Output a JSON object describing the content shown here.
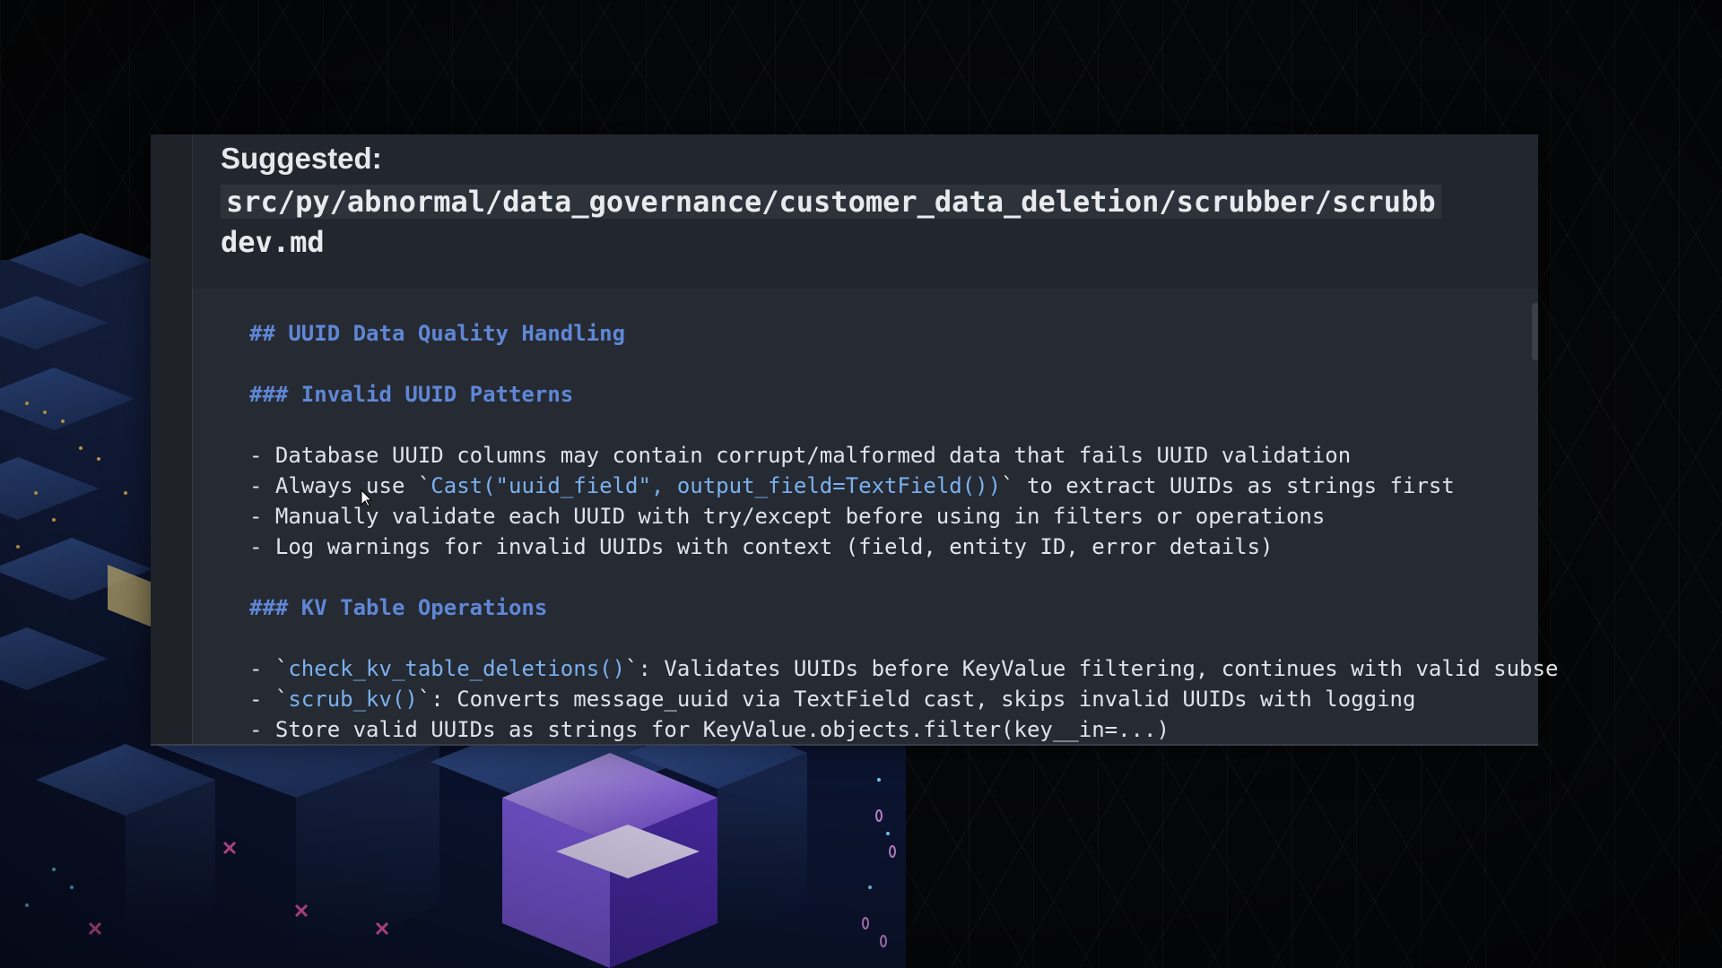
{
  "panel": {
    "suggested_label": "Suggested:",
    "file_path_line1": "src/py/abnormal/data_governance/customer_data_deletion/scrubber/scrubb",
    "file_path_line2": "dev.md"
  },
  "code": {
    "h2_uuid": "## UUID Data Quality Handling",
    "h3_invalid": "### Invalid UUID Patterns",
    "b1": "- Database UUID columns may contain corrupt/malformed data that fails UUID validation",
    "b2_prefix": "- Always use `",
    "b2_code": "Cast(\"uuid_field\", output_field=TextField())",
    "b2_suffix": "` to extract UUIDs as strings first",
    "b3": "- Manually validate each UUID with try/except before using in filters or operations",
    "b4": "- Log warnings for invalid UUIDs with context (field, entity ID, error details)",
    "h3_kv": "### KV Table Operations",
    "b5_prefix": "- `",
    "b5_code": "check_kv_table_deletions()",
    "b5_suffix": "`: Validates UUIDs before KeyValue filtering, continues with valid subse",
    "b6_prefix": "- `",
    "b6_code": "scrub_kv()",
    "b6_suffix": "`: Converts message_uuid via TextField cast, skips invalid UUIDs with logging",
    "b7": "- Store valid UUIDs as strings for KeyValue.objects.filter(key__in=...)"
  },
  "colors": {
    "panel_bg": "#22262e",
    "heading": "#5f87d6",
    "inline_code": "#7ab1ee",
    "text": "#e0e3e8"
  },
  "icons": {
    "cursor": "text-cursor-icon",
    "background_art": "isometric-cubes-illustration"
  }
}
